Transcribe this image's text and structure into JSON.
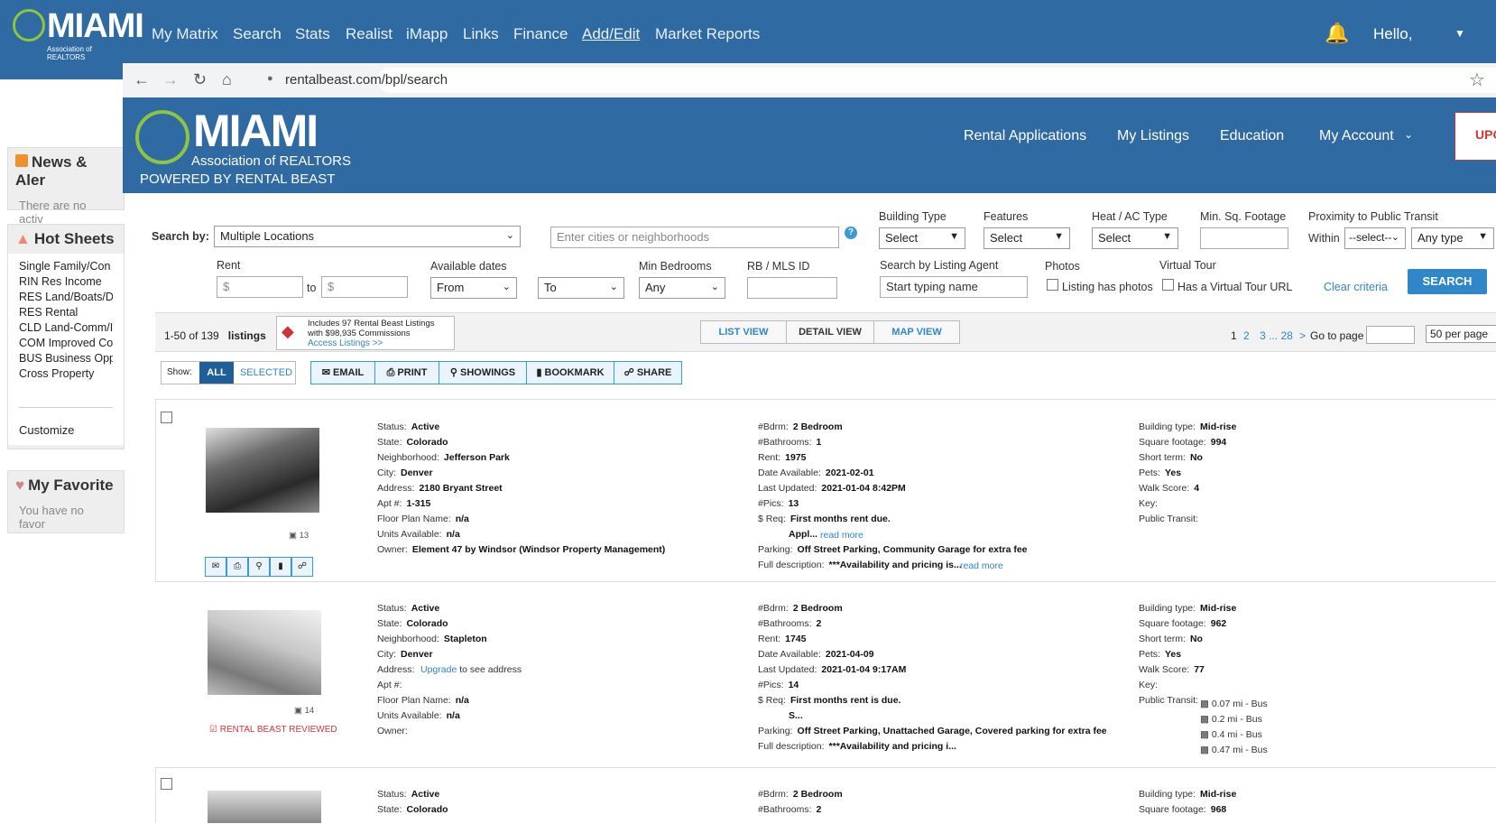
{
  "matrix": {
    "logo_text": "MIAMI",
    "logo_sub": "Association of REALTORS",
    "nav": [
      "My Matrix",
      "Search",
      "Stats",
      "Realist",
      "iMapp",
      "Links",
      "Finance",
      "Add/Edit",
      "Market Reports"
    ],
    "greeting": "Hello,"
  },
  "left": {
    "news_title": "News & Aler",
    "news_text": "There are no activ",
    "hot_title": "Hot Sheets",
    "hot_items": [
      "Single Family/Con",
      "RIN Res Income",
      "RES Land/Boats/D",
      "RES Rental",
      "CLD Land-Comm/I",
      "COM Improved Co",
      "BUS Business Opp",
      "Cross Property"
    ],
    "customize": "Customize",
    "fav_title": "My Favorite",
    "fav_text": "You have no favor"
  },
  "browser": {
    "url": "rentalbeast.com/bpl/search"
  },
  "rb": {
    "logo_text": "MIAMI",
    "logo_sub": "Association of REALTORS",
    "powered": "POWERED BY RENTAL BEAST",
    "nav": [
      "Rental Applications",
      "My Listings",
      "Education",
      "My Account"
    ],
    "upgrade": "UPG"
  },
  "search": {
    "search_by": "Search by:",
    "search_by_value": "Multiple Locations",
    "cities_placeholder": "Enter cities or neighborhoods",
    "building_type": "Building Type",
    "features": "Features",
    "heat_ac": "Heat / AC Type",
    "min_sqft": "Min. Sq. Footage",
    "proximity": "Proximity to Public Transit",
    "select": "Select",
    "within": "Within",
    "within_value": "--select--",
    "any_type": "Any type",
    "rent": "Rent",
    "currency": "$",
    "to": "to",
    "available_dates": "Available dates",
    "from": "From",
    "to_sel": "To",
    "min_bedrooms": "Min Bedrooms",
    "any": "Any",
    "rb_mls": "RB / MLS ID",
    "by_agent": "Search by Listing Agent",
    "agent_placeholder": "Start typing name",
    "photos": "Photos",
    "has_photos": "Listing has photos",
    "virtual": "Virtual Tour",
    "has_virtual": "Has a Virtual Tour URL",
    "clear": "Clear criteria",
    "search_btn": "SEARCH"
  },
  "results": {
    "count": "1-50 of 139",
    "listings": "listings",
    "promo_1": "Includes 97 Rental Beast Listings",
    "promo_2": "with $98,935 Commissions",
    "promo_link": "Access Listings >>",
    "views": [
      "LIST VIEW",
      "DETAIL VIEW",
      "MAP VIEW"
    ],
    "pages": [
      "1",
      "2",
      "3",
      "...",
      "28",
      ">"
    ],
    "go_to": "Go to page",
    "per_page": "50 per page",
    "show": "Show:",
    "all": "ALL",
    "selected": "SELECTED",
    "tools": [
      "EMAIL",
      "PRINT",
      "SHOWINGS",
      "BOOKMARK",
      "SHARE"
    ]
  },
  "listings": [
    {
      "pics": "13",
      "col1": [
        [
          "Status:",
          "Active"
        ],
        [
          "State:",
          "Colorado"
        ],
        [
          "Neighborhood:",
          "Jefferson Park"
        ],
        [
          "City:",
          "Denver"
        ],
        [
          "Address:",
          "2180 Bryant Street"
        ],
        [
          "Apt #:",
          "1-315"
        ],
        [
          "Floor Plan Name:",
          "n/a"
        ],
        [
          "Units Available:",
          "n/a"
        ],
        [
          "Owner:",
          "Element 47 by Windsor (Windsor Property Management)"
        ]
      ],
      "col2": [
        [
          "#Bdrm:",
          "2 Bedroom"
        ],
        [
          "#Bathrooms:",
          "1"
        ],
        [
          "Rent:",
          "1975"
        ],
        [
          "Date Available:",
          "2021-02-01"
        ],
        [
          "Last Updated:",
          "2021-01-04 8:42PM"
        ],
        [
          "#Pics:",
          "13"
        ],
        [
          "$ Req:",
          "First months rent due."
        ],
        [
          "",
          "Appl..."
        ],
        [
          "Parking:",
          "Off Street Parking, Community Garage for extra fee"
        ],
        [
          "Full description:",
          "***Availability and pricing is..."
        ]
      ],
      "col3": [
        [
          "Building type:",
          "Mid-rise"
        ],
        [
          "Square footage:",
          "994"
        ],
        [
          "Short term:",
          "No"
        ],
        [
          "Pets:",
          "Yes"
        ],
        [
          "Walk Score:",
          "4"
        ],
        [
          "Key:",
          ""
        ],
        [
          "Public Transit:",
          ""
        ]
      ],
      "read_more": "read more"
    },
    {
      "pics": "14",
      "reviewed": "RENTAL BEAST REVIEWED",
      "col1": [
        [
          "Status:",
          "Active"
        ],
        [
          "State:",
          "Colorado"
        ],
        [
          "Neighborhood:",
          "Stapleton"
        ],
        [
          "City:",
          "Denver"
        ],
        [
          "Address:",
          ""
        ],
        [
          "Apt #:",
          ""
        ],
        [
          "Floor Plan Name:",
          "n/a"
        ],
        [
          "Units Available:",
          "n/a"
        ],
        [
          "Owner:",
          ""
        ]
      ],
      "upgrade_link": "Upgrade",
      "upgrade_text": "to see address",
      "col2": [
        [
          "#Bdrm:",
          "2 Bedroom"
        ],
        [
          "#Bathrooms:",
          "2"
        ],
        [
          "Rent:",
          "1745"
        ],
        [
          "Date Available:",
          "2021-04-09"
        ],
        [
          "Last Updated:",
          "2021-01-04 9:17AM"
        ],
        [
          "#Pics:",
          "14"
        ],
        [
          "$ Req:",
          "First months rent is due."
        ],
        [
          "",
          "S..."
        ],
        [
          "Parking:",
          "Off Street Parking, Unattached Garage, Covered parking for extra fee"
        ],
        [
          "Full description:",
          "***Availability and pricing i..."
        ]
      ],
      "col3": [
        [
          "Building type:",
          "Mid-rise"
        ],
        [
          "Square footage:",
          "962"
        ],
        [
          "Short term:",
          "No"
        ],
        [
          "Pets:",
          "Yes"
        ],
        [
          "Walk Score:",
          "77"
        ],
        [
          "Key:",
          ""
        ],
        [
          "Public Transit:",
          ""
        ]
      ],
      "transit": [
        "0.07 mi - Bus",
        "0.2 mi - Bus",
        "0.4 mi - Bus",
        "0.47 mi - Bus"
      ]
    },
    {
      "col1": [
        [
          "Status:",
          "Active"
        ],
        [
          "State:",
          "Colorado"
        ]
      ],
      "col2": [
        [
          "#Bdrm:",
          "2 Bedroom"
        ],
        [
          "#Bathrooms:",
          "2"
        ]
      ],
      "col3": [
        [
          "Building type:",
          "Mid-rise"
        ],
        [
          "Square footage:",
          "968"
        ]
      ]
    }
  ]
}
